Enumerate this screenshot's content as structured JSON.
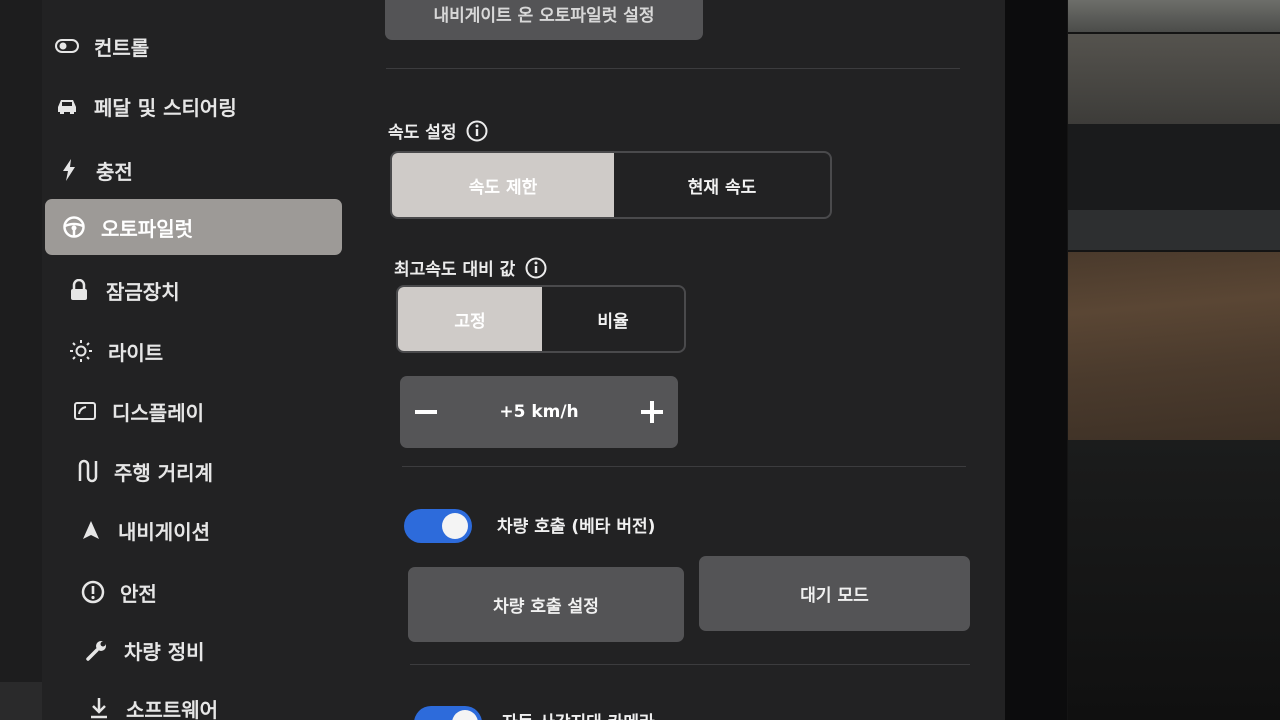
{
  "sidebar": {
    "items": [
      {
        "label": "컨트롤",
        "icon": "toggle-icon"
      },
      {
        "label": "페달 및 스티어링",
        "icon": "car-icon"
      },
      {
        "label": "충전",
        "icon": "bolt-icon"
      },
      {
        "label": "오토파일럿",
        "icon": "steering-wheel-icon",
        "active": true
      },
      {
        "label": "잠금장치",
        "icon": "lock-icon"
      },
      {
        "label": "라이트",
        "icon": "sun-icon"
      },
      {
        "label": "디스플레이",
        "icon": "display-icon"
      },
      {
        "label": "주행 거리계",
        "icon": "route-icon"
      },
      {
        "label": "내비게이션",
        "icon": "navigation-arrow-icon"
      },
      {
        "label": "안전",
        "icon": "alert-circle-icon"
      },
      {
        "label": "차량 정비",
        "icon": "wrench-icon"
      },
      {
        "label": "소프트웨어",
        "icon": "download-icon"
      }
    ]
  },
  "main": {
    "top_button": "내비게이트 온 오토파일럿 설정",
    "speed_setting": {
      "heading": "속도 설정",
      "options": [
        "속도 제한",
        "현재 속도"
      ],
      "selected": "속도 제한"
    },
    "offset": {
      "heading": "최고속도 대비 값",
      "options": [
        "고정",
        "비율"
      ],
      "selected": "고정"
    },
    "stepper": {
      "value": "+5 km/h",
      "minus": "−",
      "plus": "+"
    },
    "summon": {
      "toggle_label": "차량 호출 (베타 버전)",
      "enabled": true,
      "buttons": [
        "차량 호출 설정",
        "대기 모드"
      ]
    },
    "bottom_toggle_label": "자동 사각지대 카메라"
  },
  "colors": {
    "accent": "#2d6bdb",
    "selected_segment": "#cfcbc8",
    "screen_bg": "#222223"
  }
}
